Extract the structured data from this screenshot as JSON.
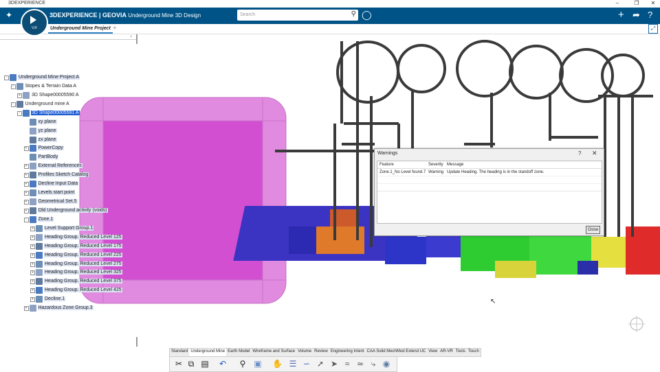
{
  "window": {
    "title": "3DEXPERIENCE"
  },
  "appbar": {
    "brand": "3DEXPERIENCE | GEOVIA",
    "app": "Underground Mine 3D Design",
    "search_placeholder": "Search",
    "compass_label": "V,R"
  },
  "tabs": [
    {
      "label": "Underground Mine Project"
    }
  ],
  "tree": [
    {
      "label": "Underground Mine Project A",
      "level": 0,
      "style": "hl",
      "expander": "-"
    },
    {
      "label": "Stopes & Terrain Data A",
      "level": 1,
      "style": "",
      "expander": "-"
    },
    {
      "label": "3D Shape00005590 A",
      "level": 2,
      "style": "",
      "expander": "+"
    },
    {
      "label": "Underground mine A",
      "level": 1,
      "style": "",
      "expander": "-"
    },
    {
      "label": "3D Shape00005591 A",
      "level": 2,
      "style": "sel",
      "expander": "-"
    },
    {
      "label": "xy plane",
      "level": 3,
      "style": "hl",
      "expander": ""
    },
    {
      "label": "yz plane",
      "level": 3,
      "style": "hl",
      "expander": ""
    },
    {
      "label": "zx plane",
      "level": 3,
      "style": "hl",
      "expander": ""
    },
    {
      "label": "PowerCopy",
      "level": 3,
      "style": "hl",
      "expander": "+"
    },
    {
      "label": "PartBody",
      "level": 3,
      "style": "hl",
      "expander": ""
    },
    {
      "label": "External References",
      "level": 3,
      "style": "hl",
      "expander": "+"
    },
    {
      "label": "Profiles Sketch Catalog",
      "level": 3,
      "style": "hl",
      "expander": "+"
    },
    {
      "label": "Decline Input Data",
      "level": 3,
      "style": "hl",
      "expander": "+"
    },
    {
      "label": "Levels start point",
      "level": 3,
      "style": "hl",
      "expander": "+"
    },
    {
      "label": "Geometrical Set.5",
      "level": 3,
      "style": "hl",
      "expander": "+"
    },
    {
      "label": "Old Underground activity (voids)",
      "level": 3,
      "style": "hl",
      "expander": "+"
    },
    {
      "label": "Zone.1",
      "level": 3,
      "style": "hl",
      "expander": "-"
    },
    {
      "label": "Level Support Group.1",
      "level": 4,
      "style": "hl",
      "expander": "+"
    },
    {
      "label": "Heading Group. Reduced Level 125",
      "level": 4,
      "style": "hl",
      "expander": "+"
    },
    {
      "label": "Heading Group. Reduced Level 175",
      "level": 4,
      "style": "hl",
      "expander": "+"
    },
    {
      "label": "Heading Group. Reduced Level 225",
      "level": 4,
      "style": "hl",
      "expander": "+"
    },
    {
      "label": "Heading Group. Reduced Level 275",
      "level": 4,
      "style": "hl",
      "expander": "+"
    },
    {
      "label": "Heading Group. Reduced Level 325",
      "level": 4,
      "style": "hl",
      "expander": "+"
    },
    {
      "label": "Heading Group. Reduced Level 375",
      "level": 4,
      "style": "hl",
      "expander": "+"
    },
    {
      "label": "Heading Group. Reduced Level 425",
      "level": 4,
      "style": "hl",
      "expander": "+"
    },
    {
      "label": "Decline.1",
      "level": 4,
      "style": "hl",
      "expander": "+"
    },
    {
      "label": "Hazardous Zone Group.3",
      "level": 3,
      "style": "hl",
      "expander": "+"
    }
  ],
  "dialog": {
    "title": "Warnings",
    "columns": [
      "Feature",
      "Severity",
      "Message"
    ],
    "rows": [
      {
        "feature": "Zone.1_No Level found.7",
        "severity": "Warning",
        "message": "Update Heading. The heading is in the standoff zone."
      }
    ],
    "close_label": "Close"
  },
  "action_tabs": [
    {
      "label": "Standard"
    },
    {
      "label": "Underground Mine"
    },
    {
      "label": "Earth Model"
    },
    {
      "label": "Wireframe and Surface"
    },
    {
      "label": "Volume"
    },
    {
      "label": "Review"
    },
    {
      "label": "Engineering Intent"
    },
    {
      "label": "CAA Solid MechMod Extend UC"
    },
    {
      "label": "View"
    },
    {
      "label": "AR-VR"
    },
    {
      "label": "Tools"
    },
    {
      "label": "Touch"
    }
  ],
  "colors": {
    "appbar": "#005386",
    "selection": "#1d5bd1",
    "highlight": "#dde4f3",
    "box": "#d254d2"
  }
}
